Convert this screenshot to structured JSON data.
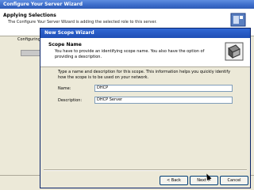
{
  "outer_wizard": {
    "title": "Configure Your Server Wizard",
    "header_title": "Applying Selections",
    "header_subtitle": "The Configure Your Server Wizard is adding the selected role to this server.",
    "left_label": "Configuring"
  },
  "dialog": {
    "title": "New Scope Wizard",
    "header_title": "Scope Name",
    "header_subtitle": "You have to provide an identifying scope name. You also have the option of providing a description.",
    "instructions": "Type a name and description for this scope. This information helps you quickly identify how the scope is to be used on your network.",
    "name_label": "Name:",
    "name_value": "DHCP",
    "description_label": "Description:",
    "description_value": "DHCP Server",
    "back_label": "< Back",
    "next_label": "Next >",
    "cancel_label": "Cancel"
  }
}
